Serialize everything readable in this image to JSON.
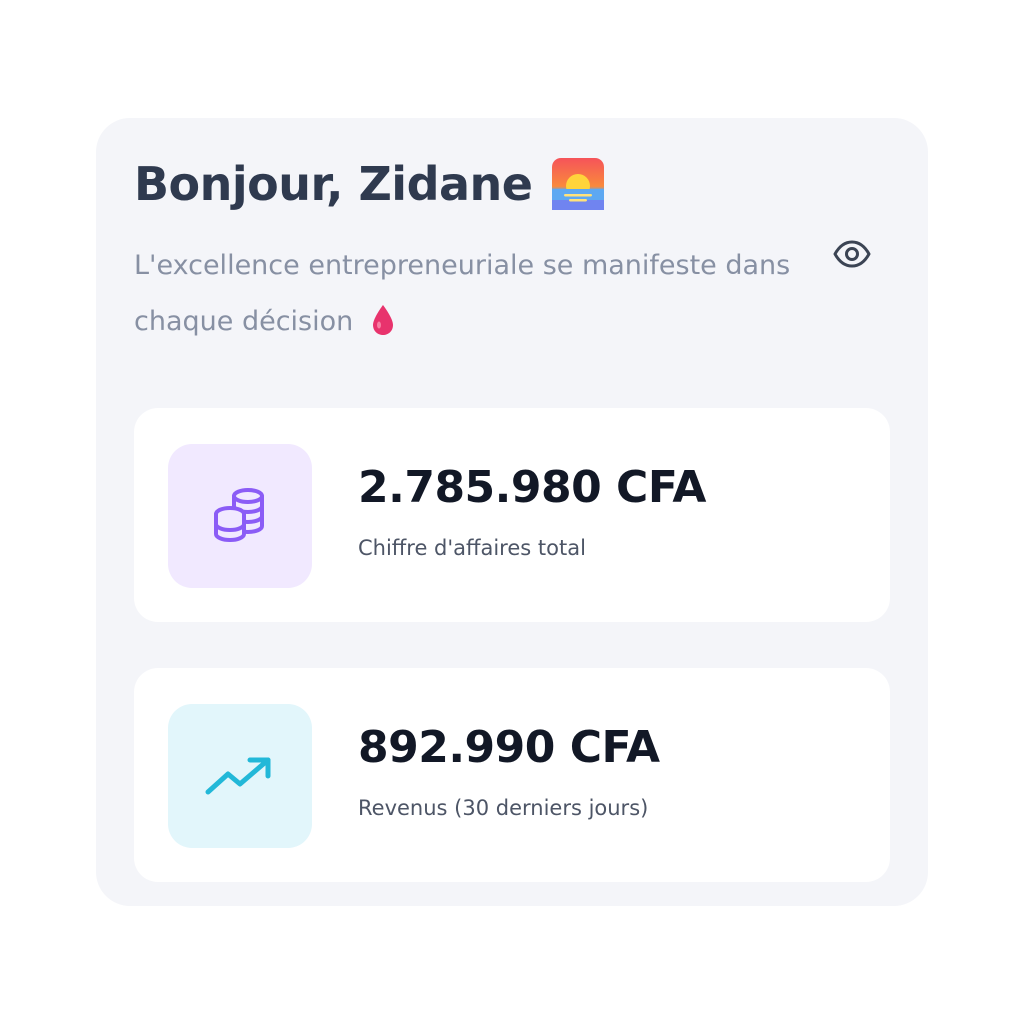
{
  "header": {
    "greeting": "Bonjour, Zidane",
    "greeting_icon": "sunrise-icon",
    "subtitle": "L'excellence entrepreneuriale se manifeste dans chaque décision",
    "subtitle_icon": "drop-icon",
    "visibility_toggle_icon": "eye-icon"
  },
  "stats": [
    {
      "value": "2.785.980 CFA",
      "label": "Chiffre d'affaires total",
      "icon": "coins-icon",
      "icon_bg": "#f1e9ff",
      "icon_color": "#8b5cf6"
    },
    {
      "value": "892.990 CFA",
      "label": "Revenus (30 derniers jours)",
      "icon": "trending-up-icon",
      "icon_bg": "#e2f6fb",
      "icon_color": "#22b8d8"
    }
  ],
  "colors": {
    "panel_bg": "#f4f5f9",
    "card_bg": "#ffffff",
    "title": "#2f3a4f",
    "subtitle": "#8790a3",
    "value": "#121826",
    "label": "#4d5566"
  }
}
